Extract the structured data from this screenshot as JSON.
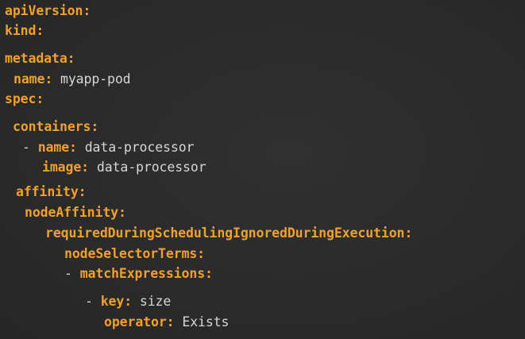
{
  "colors": {
    "background": "#2a2a2a",
    "key": "#f0a030",
    "value": "#d6d6d6"
  },
  "yaml": {
    "apiVersion": "apiVersion:",
    "kind": "kind:",
    "metadata": "metadata:",
    "name_key": "name:",
    "name_value": "myapp-pod",
    "spec": "spec:",
    "containers": "containers:",
    "dash": "-",
    "container_name_key": "name:",
    "container_name_value": "data-processor",
    "image_key": "image:",
    "image_value": "data-processor",
    "affinity": "affinity:",
    "nodeAffinity": "nodeAffinity:",
    "required": "requiredDuringSchedulingIgnoredDuringExecution:",
    "nodeSelectorTerms": "nodeSelectorTerms:",
    "matchExpressions": "matchExpressions:",
    "key_key": "key:",
    "key_value": "size",
    "operator_key": "operator:",
    "operator_value": "Exists"
  }
}
